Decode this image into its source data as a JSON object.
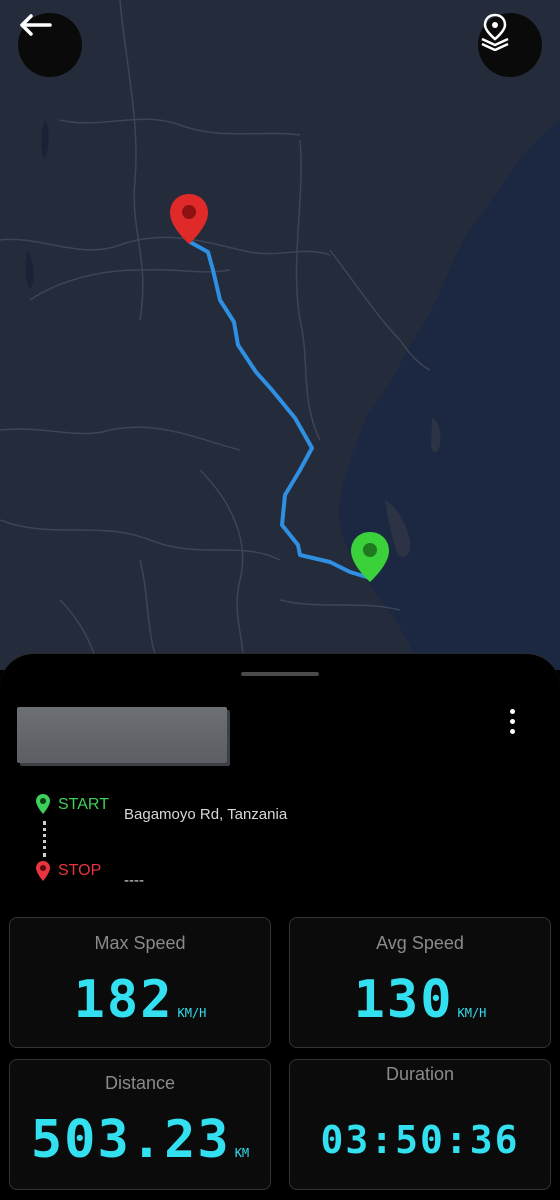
{
  "map": {
    "route_color": "#2f8fe3",
    "start_pin_color": "#3ad13a",
    "stop_pin_color": "#e02a2a"
  },
  "header": {
    "back_icon": "arrow-left-icon",
    "layers_icon": "map-layers-pin-icon"
  },
  "trip": {
    "title": "",
    "start_label": "START",
    "start_value": "Bagamoyo Rd, Tanzania",
    "stop_label": "STOP",
    "stop_value": "----"
  },
  "stats": {
    "max_speed": {
      "label": "Max Speed",
      "value": "182",
      "unit": "KM/H"
    },
    "avg_speed": {
      "label": "Avg Speed",
      "value": "130",
      "unit": "KM/H"
    },
    "distance": {
      "label": "Distance",
      "value": "503.23",
      "unit": "KM"
    },
    "duration": {
      "label": "Duration",
      "value": "03:50:36"
    }
  },
  "colors": {
    "accent_digits": "#33e0f0",
    "start_green": "#3ecf5a",
    "stop_red": "#e8343c"
  }
}
